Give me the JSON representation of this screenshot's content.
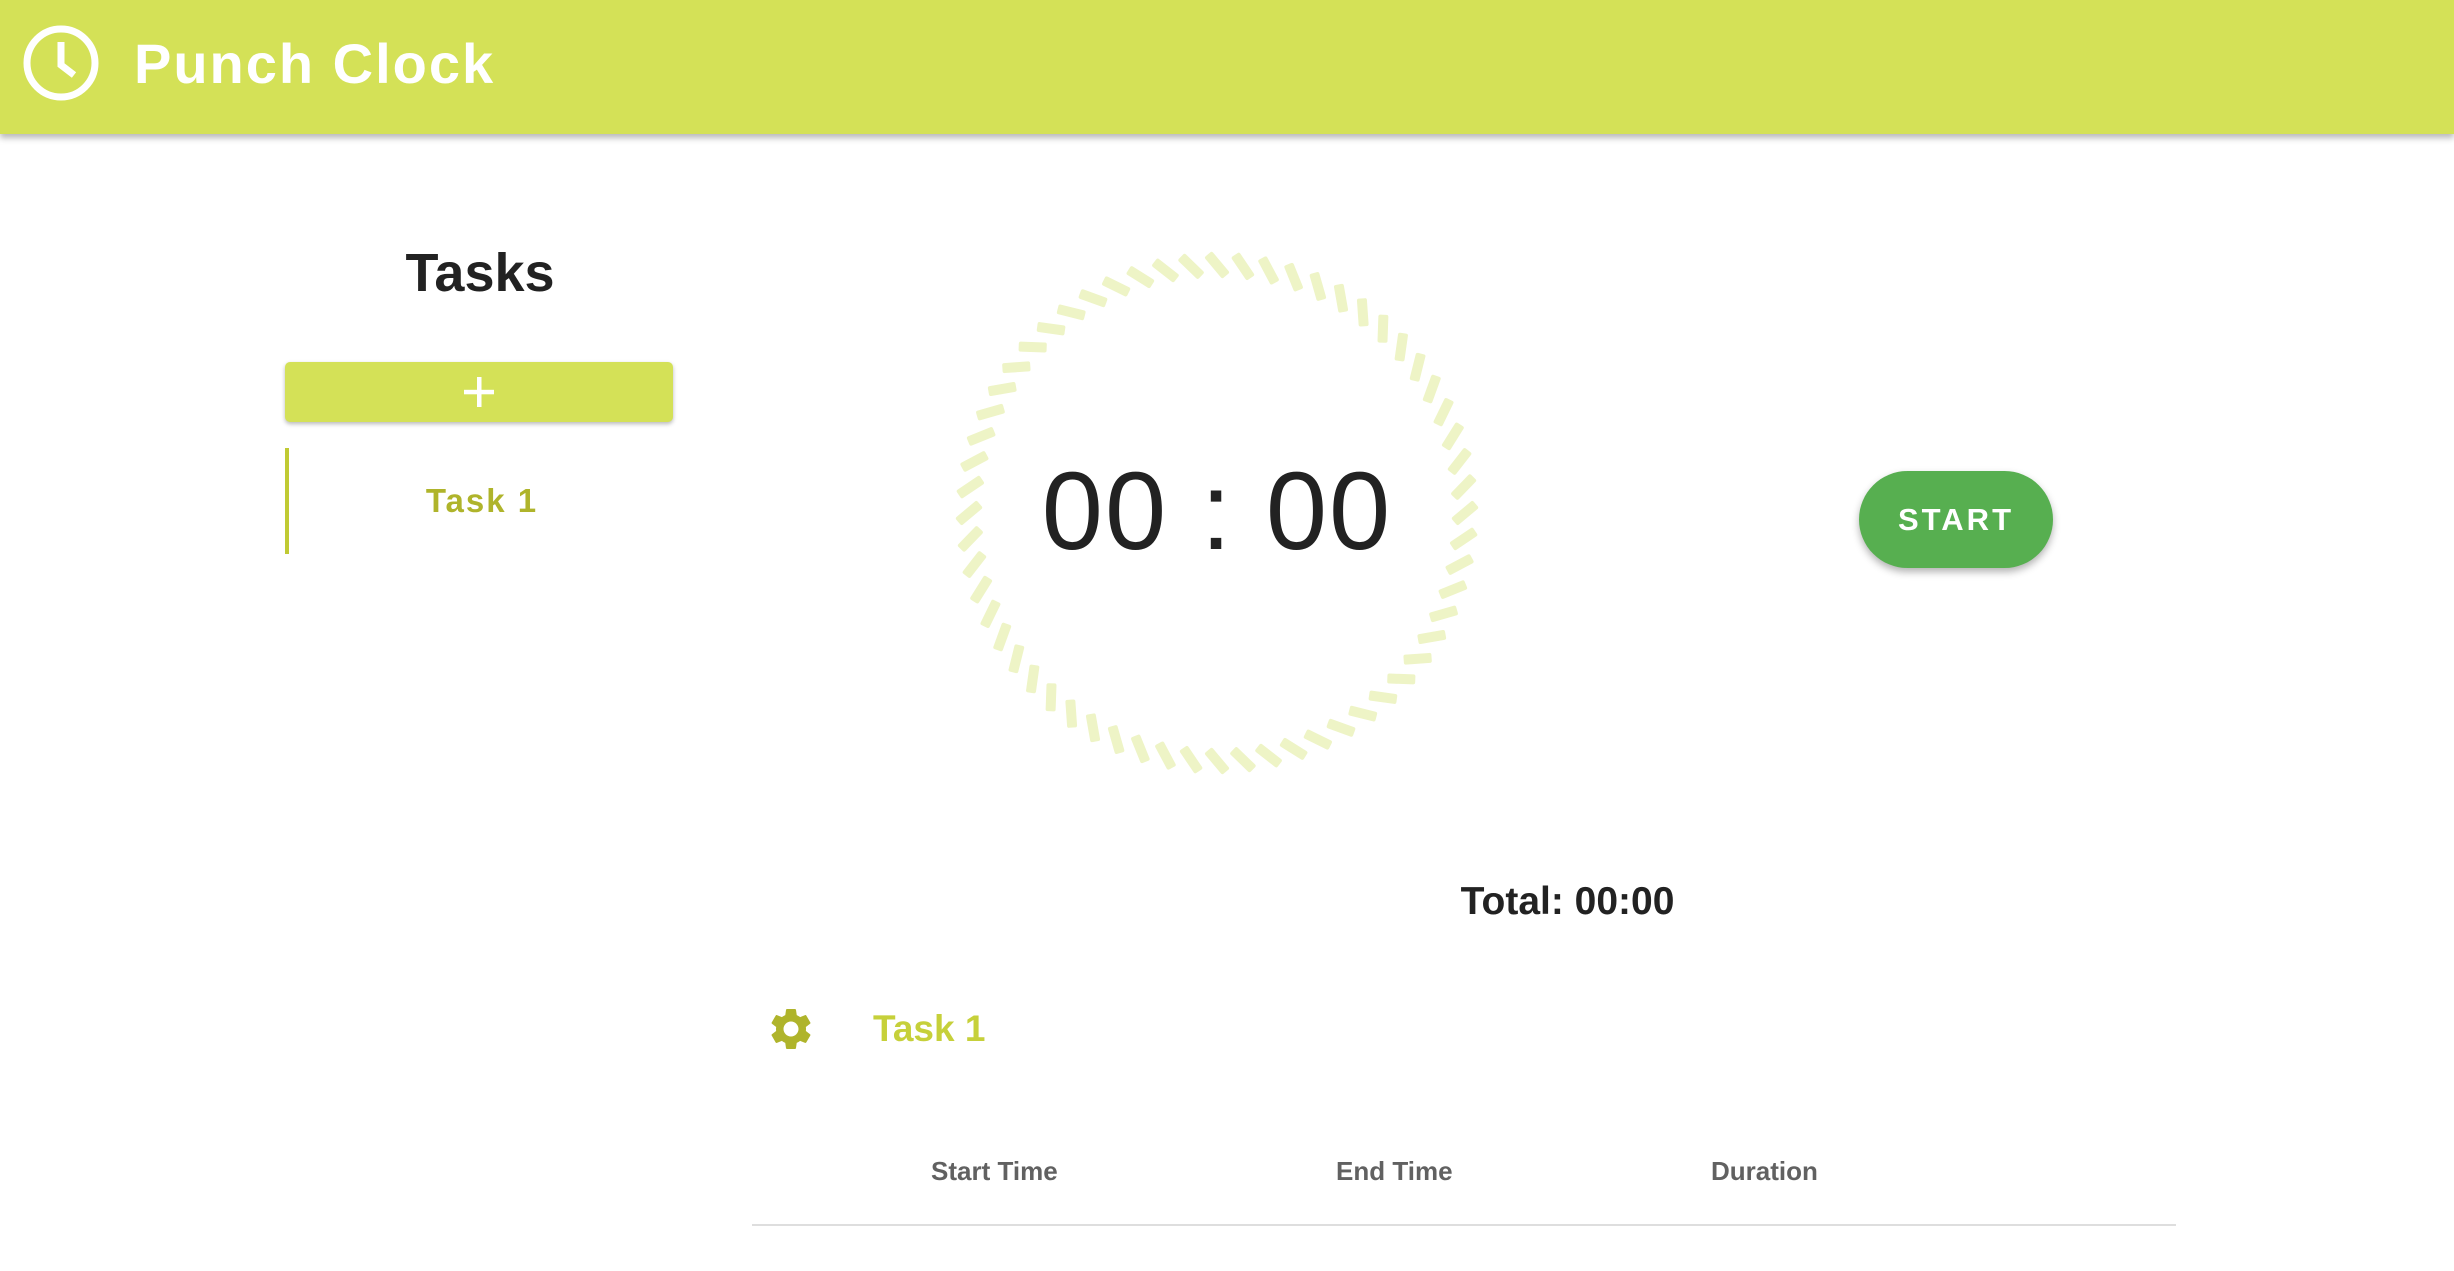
{
  "app": {
    "title": "Punch Clock",
    "accent_color": "#d4e157",
    "icon": "clock-icon"
  },
  "sidebar": {
    "heading": "Tasks",
    "add_button_icon": "plus-icon",
    "tasks": [
      {
        "label": "Task 1",
        "selected": true
      }
    ]
  },
  "timer": {
    "display": "00 : 00",
    "start_button_label": "START",
    "start_button_color": "#57af50"
  },
  "summary": {
    "total_label": "Total: 00:00",
    "settings_icon": "gear-icon",
    "current_task": "Task 1",
    "table": {
      "columns": [
        "Start Time",
        "End Time",
        "Duration"
      ],
      "rows": []
    }
  }
}
